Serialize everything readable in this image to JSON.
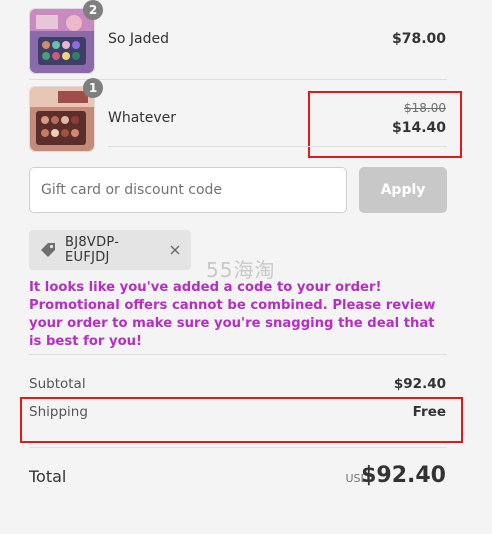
{
  "items": [
    {
      "name": "So Jaded",
      "quantity": "2",
      "price": "$78.00"
    },
    {
      "name": "Whatever",
      "quantity": "1",
      "original_price": "$18.00",
      "price": "$14.40"
    }
  ],
  "discount": {
    "placeholder": "Gift card or discount code",
    "apply_label": "Apply",
    "applied_code": "BJ8VDP-EUFJDJ"
  },
  "notice": "It looks like you've added a code to your order! Promotional offers cannot be combined. Please review your order to make sure you're snagging the deal that is best for you!",
  "watermark": "55海淘",
  "summary": {
    "subtotal_label": "Subtotal",
    "subtotal_value": "$92.40",
    "shipping_label": "Shipping",
    "shipping_value": "Free",
    "total_label": "Total",
    "currency": "USD",
    "total_value": "$92.40"
  },
  "colors": {
    "accent_highlight": "#e01b1b",
    "notice_text": "#b52fc2",
    "apply_disabled": "#c8c8c8"
  }
}
